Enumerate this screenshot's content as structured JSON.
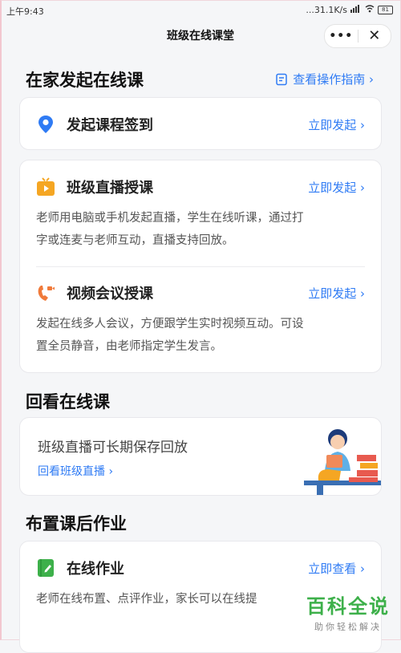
{
  "status_bar": {
    "time": "上午9:43",
    "network": "...31.1K/s",
    "battery": "81"
  },
  "title_bar": {
    "title": "班级在线课堂",
    "more": "•••",
    "close": "✕"
  },
  "section_home": {
    "title": "在家发起在线课",
    "guide_link": "查看操作指南 ›"
  },
  "checkin": {
    "label": "发起课程签到",
    "action": "立即发起 ›"
  },
  "live_class": {
    "label": "班级直播授课",
    "action": "立即发起 ›",
    "desc_line1": "老师用电脑或手机发起直播，学生在线听课，通过打",
    "desc_line2": "字或连麦与老师互动，直播支持回放。"
  },
  "video_meeting": {
    "label": "视频会议授课",
    "action": "立即发起 ›",
    "desc_line1": "发起在线多人会议，方便跟学生实时视频互动。可设",
    "desc_line2": "置全员静音，由老师指定学生发言。"
  },
  "section_replay": {
    "title": "回看在线课",
    "text": "班级直播可长期保存回放",
    "link": "回看班级直播 ›"
  },
  "section_homework": {
    "title": "布置课后作业"
  },
  "homework": {
    "label": "在线作业",
    "action": "立即查看 ›",
    "desc": "老师在线布置、点评作业，家长可以在线提"
  },
  "watermark": {
    "big": "百科全说",
    "small": "助你轻松解决"
  },
  "colors": {
    "accent": "#2f7bf4",
    "orange": "#f5a623",
    "video_orange": "#f07a3a",
    "green": "#3db04a"
  }
}
